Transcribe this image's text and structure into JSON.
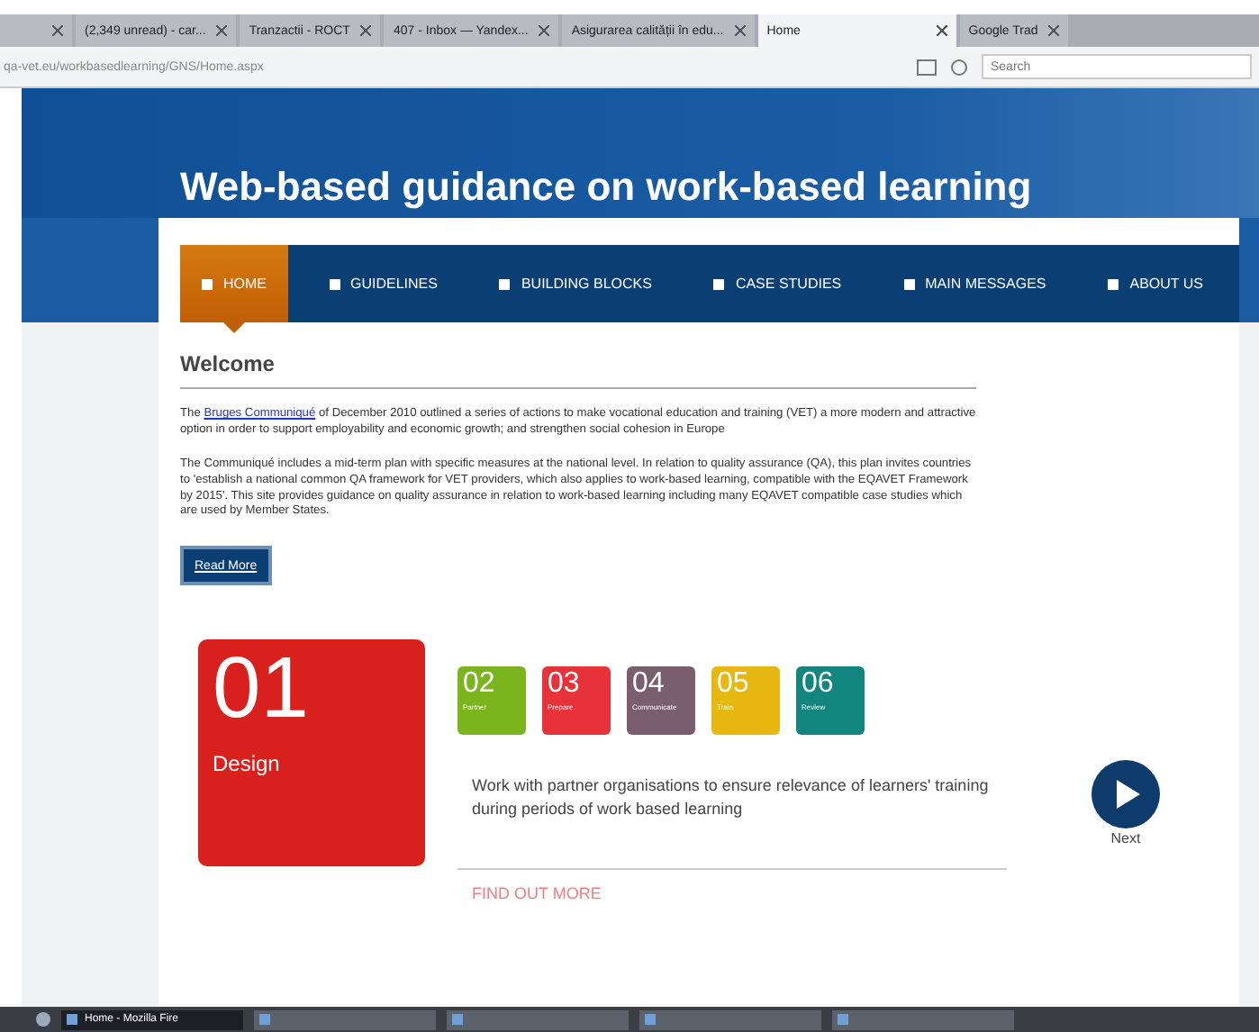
{
  "browser": {
    "tabs": [
      {
        "selected": false
      },
      {
        "label": "(2,349 unread) - car...",
        "selected": false
      },
      {
        "label": "Tranzactii - ROCT",
        "selected": false
      },
      {
        "label": "407 - Inbox — Yandex...",
        "selected": false
      },
      {
        "label": "Asigurarea calității în edu...",
        "selected": false
      },
      {
        "label": "Home",
        "selected": true
      },
      {
        "label": "Google Trad",
        "selected": false
      }
    ],
    "address": "qa-vet.eu/workbasedlearning/GNS/Home.aspx",
    "search": {
      "placeholder": "Search"
    }
  },
  "page": {
    "title": "Web-based guidance on work-based learning",
    "nav": [
      {
        "label": "HOME",
        "selected": true
      },
      {
        "label": "GUIDELINES",
        "selected": false
      },
      {
        "label": "BUILDING BLOCKS",
        "selected": false
      },
      {
        "label": "CASE STUDIES",
        "selected": false
      },
      {
        "label": "MAIN MESSAGES",
        "selected": false
      },
      {
        "label": "ABOUT US",
        "selected": false
      }
    ],
    "heading": "Welcome",
    "paragraphs": [
      {
        "before": "The ",
        "link": "Bruges Communiqué",
        "after": " of December 2010 outlined a series of actions to make vocational education and training (VET) a more modern and attractive option in order to support employability and economic growth; and strengthen social cohesion in Europe"
      },
      {
        "before": "The Communiqué includes a mid-term plan with specific measures at the national level. In relation to quality assurance (QA), this plan invites countries to 'establish a national common QA framework for VET providers, which also applies to work-based learning, compatible with the EQAVET Framework by 2015'. This site provides guidance on quality assurance in relation to work-based learning including many EQAVET compatible case studies which are used by Member States."
      }
    ],
    "read_more": "Read More",
    "feature": {
      "number": "01",
      "label": "Design",
      "color": "#d8201c"
    },
    "tiles": [
      {
        "number": "02",
        "label": "Partner",
        "color": "#7ab51d"
      },
      {
        "number": "03",
        "label": "Prepare",
        "color": "#e8323a"
      },
      {
        "number": "04",
        "label": "Communicate",
        "color": "#7a5e6e"
      },
      {
        "number": "05",
        "label": "Train",
        "color": "#e8b812"
      },
      {
        "number": "06",
        "label": "Review",
        "color": "#12857e"
      }
    ],
    "description": "Work with partner organisations to ensure relevance of learners' training during periods of work based learning",
    "find_out_more": "FIND OUT MORE",
    "next": "Next"
  },
  "taskbar": [
    {
      "label": "Home - Mozilla Fire",
      "selected": true
    },
    {
      "selected": false
    },
    {
      "selected": false
    },
    {
      "selected": false
    },
    {
      "selected": false
    }
  ]
}
